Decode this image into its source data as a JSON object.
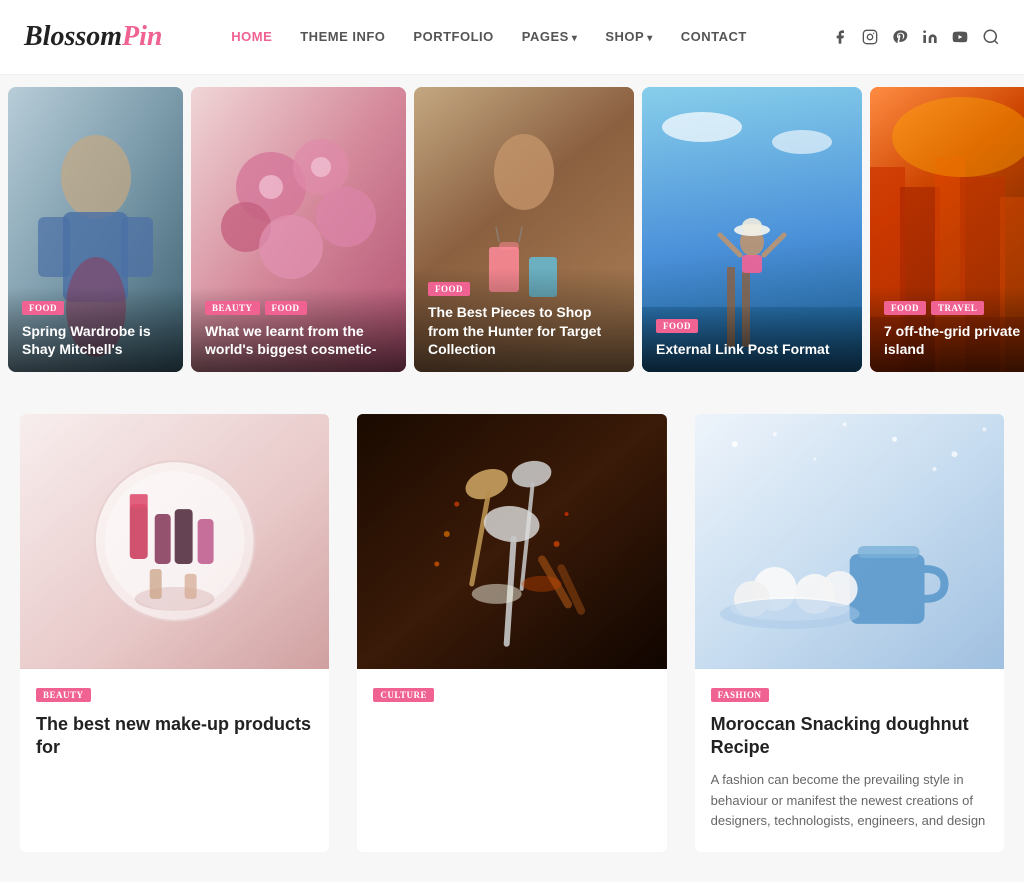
{
  "site": {
    "logo": {
      "blossom": "Blossom",
      "pin": "Pin"
    }
  },
  "nav": {
    "items": [
      {
        "id": "home",
        "label": "HOME",
        "active": true,
        "hasDropdown": false
      },
      {
        "id": "theme-info",
        "label": "THEME INFO",
        "active": false,
        "hasDropdown": false
      },
      {
        "id": "portfolio",
        "label": "PORTFOLIO",
        "active": false,
        "hasDropdown": false
      },
      {
        "id": "pages",
        "label": "PAGES",
        "active": false,
        "hasDropdown": true
      },
      {
        "id": "shop",
        "label": "SHOP",
        "active": false,
        "hasDropdown": true
      },
      {
        "id": "contact",
        "label": "CONTACT",
        "active": false,
        "hasDropdown": false
      }
    ]
  },
  "social_icons": [
    "facebook",
    "instagram",
    "pinterest",
    "linkedin",
    "youtube",
    "search"
  ],
  "slider": {
    "cards": [
      {
        "id": "card1",
        "tags": [
          "FOOD"
        ],
        "title": "Spring Wardrobe is Shay Mitchell's",
        "imgClass": "img-denim",
        "size": "card-sm"
      },
      {
        "id": "card2",
        "tags": [
          "BEAUTY",
          "FOOD"
        ],
        "title": "What we learnt from the world's biggest cosmetic-",
        "imgClass": "img-flowers",
        "size": "card-md"
      },
      {
        "id": "card3",
        "tags": [
          "FOOD"
        ],
        "title": "The Best Pieces to Shop from the Hunter for Target Collection",
        "imgClass": "img-shopping",
        "size": "card-lg"
      },
      {
        "id": "card4",
        "tags": [
          "FOOD"
        ],
        "title": "External Link Post Format",
        "imgClass": "img-beach",
        "size": "card-xl"
      },
      {
        "id": "card5",
        "tags": [
          "FOOD",
          "TRAVEL"
        ],
        "title": "7 off-the-grid private island",
        "imgClass": "img-canal",
        "size": "card-partial"
      }
    ]
  },
  "articles": [
    {
      "id": "article1",
      "tag": "BEAUTY",
      "title": "The best new make-up products for",
      "excerpt": "",
      "imgClass": "img-lipstick"
    },
    {
      "id": "article2",
      "tag": "CULTURE",
      "title": "",
      "excerpt": "",
      "imgClass": "img-spices"
    },
    {
      "id": "article3",
      "tag": "FASHION",
      "title": "Moroccan Snacking doughnut Recipe",
      "excerpt": "A fashion can become the prevailing style in behaviour or manifest the newest creations of designers, technologists, engineers, and design",
      "imgClass": "img-winter"
    }
  ]
}
